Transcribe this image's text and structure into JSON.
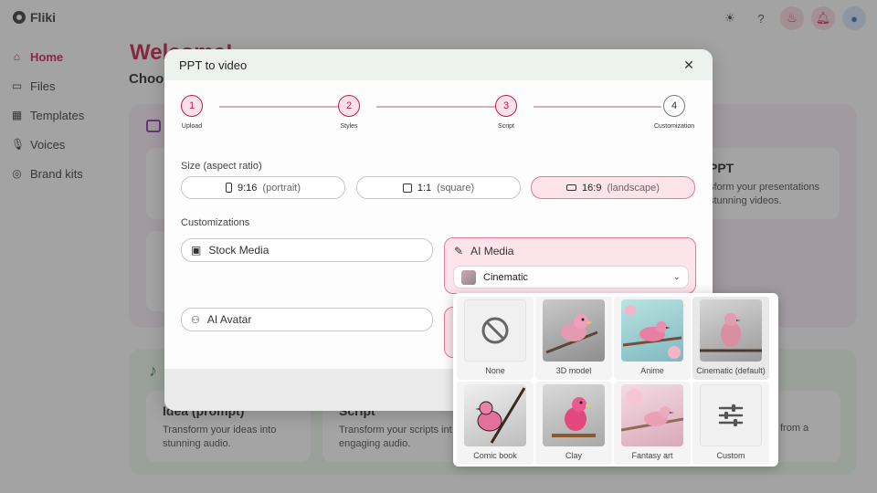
{
  "app": {
    "logo_text": "Fliki",
    "welcome": "Welcome!",
    "choose": "Choos",
    "sidebar": [
      {
        "label": "Home",
        "icon": "home-icon",
        "active": true
      },
      {
        "label": "Files",
        "icon": "folder-icon"
      },
      {
        "label": "Templates",
        "icon": "templates-icon"
      },
      {
        "label": "Voices",
        "icon": "microphone-icon"
      },
      {
        "label": "Brand kits",
        "icon": "palette-icon"
      }
    ],
    "cards": {
      "ppt_title": "PPT",
      "ppt_desc_1": "sform your presentations",
      "ppt_desc_2": "stunning videos.",
      "idea_title": "Idea (prompt)",
      "idea_desc_1": "Transform your ideas into",
      "idea_desc_2": "stunning audio.",
      "script_title": "Script",
      "script_desc_1": "Transform your scripts int",
      "script_desc_2": "engaging audio.",
      "right_desc": "from a"
    }
  },
  "modal": {
    "title": "PPT to video",
    "steps": [
      {
        "number": "1",
        "label": "Upload",
        "active": true
      },
      {
        "number": "2",
        "label": "Styles",
        "active": true
      },
      {
        "number": "3",
        "label": "Script",
        "active": true
      },
      {
        "number": "4",
        "label": "Customization",
        "active": false
      }
    ],
    "size_label": "Size (aspect ratio)",
    "sizes": [
      {
        "value": "9:16",
        "hint": "(portrait)",
        "selected": false
      },
      {
        "value": "1:1",
        "hint": "(square)",
        "selected": false
      },
      {
        "value": "16:9",
        "hint": "(landscape)",
        "selected": true
      }
    ],
    "customizations_label": "Customizations",
    "stock_media": "Stock Media",
    "ai_avatar": "AI Avatar",
    "ai_media": "AI Media",
    "ai_media_selected": "Cinematic"
  },
  "dropdown": {
    "styles": [
      {
        "name": "None",
        "selected": false
      },
      {
        "name": "3D model",
        "selected": false
      },
      {
        "name": "Anime",
        "selected": false
      },
      {
        "name": "Cinematic (default)",
        "selected": true
      },
      {
        "name": "Comic book",
        "selected": false
      },
      {
        "name": "Clay",
        "selected": false
      },
      {
        "name": "Fantasy art",
        "selected": false
      },
      {
        "name": "Custom",
        "selected": false
      }
    ]
  },
  "colors": {
    "accent": "#c2184a",
    "selected_bg": "#fde4ea"
  }
}
